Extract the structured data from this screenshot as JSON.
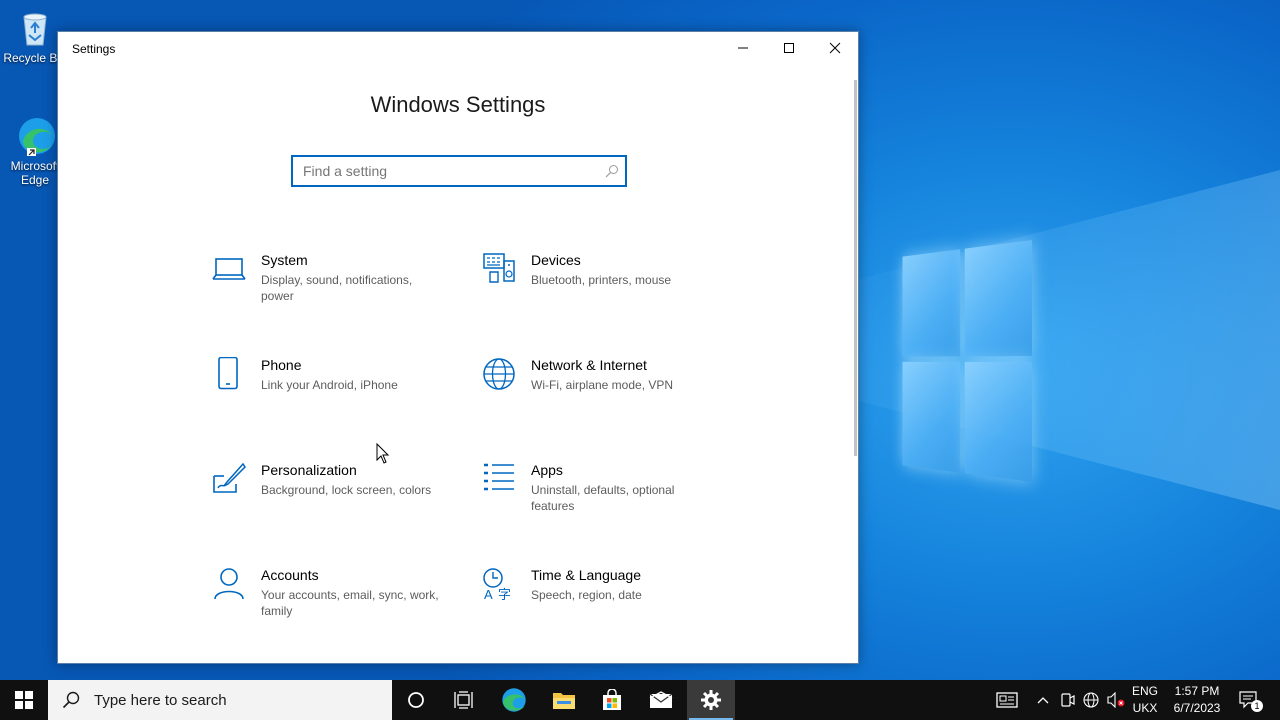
{
  "desktop": {
    "icons": [
      {
        "label": "Recycle Bin"
      },
      {
        "label": "Microsoft Edge"
      }
    ]
  },
  "window": {
    "title": "Settings",
    "heading": "Windows Settings",
    "search": {
      "placeholder": "Find a setting"
    },
    "tiles": [
      {
        "title": "System",
        "subtitle": "Display, sound, notifications, power",
        "icon": "laptop-icon"
      },
      {
        "title": "Devices",
        "subtitle": "Bluetooth, printers, mouse",
        "icon": "devices-icon"
      },
      {
        "title": "Phone",
        "subtitle": "Link your Android, iPhone",
        "icon": "phone-icon"
      },
      {
        "title": "Network & Internet",
        "subtitle": "Wi-Fi, airplane mode, VPN",
        "icon": "globe-icon"
      },
      {
        "title": "Personalization",
        "subtitle": "Background, lock screen, colors",
        "icon": "paint-icon"
      },
      {
        "title": "Apps",
        "subtitle": "Uninstall, defaults, optional features",
        "icon": "apps-list-icon"
      },
      {
        "title": "Accounts",
        "subtitle": "Your accounts, email, sync, work, family",
        "icon": "person-icon"
      },
      {
        "title": "Time & Language",
        "subtitle": "Speech, region, date",
        "icon": "time-language-icon"
      }
    ]
  },
  "taskbar": {
    "search_placeholder": "Type here to search",
    "language_top": "ENG",
    "language_bottom": "UKX",
    "time": "1:57 PM",
    "date": "6/7/2023",
    "notification_count": "1"
  },
  "colors": {
    "accent": "#0067c0",
    "taskbar": "#101010"
  }
}
